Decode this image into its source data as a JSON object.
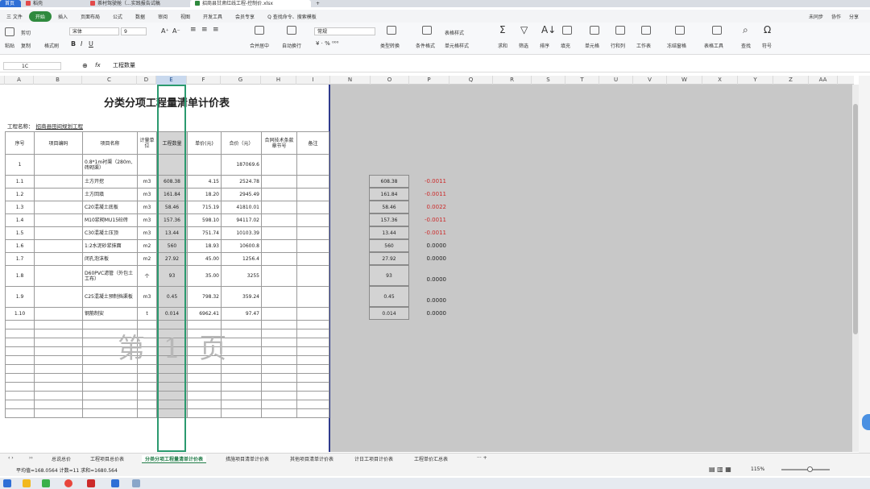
{
  "titlebar": {
    "tabs": [
      "首页",
      "稻壳",
      "茶村驾驶舱（...实践报告试稿",
      "招商县甘肃红线工程-控制价.xlsx",
      "+"
    ]
  },
  "menubar": {
    "items": [
      "三 文件",
      "开始",
      "插入",
      "页面布局",
      "公式",
      "数据",
      "审阅",
      "视图",
      "开发工具",
      "会员专享",
      "Q 查找命令、搜索模板"
    ],
    "right": [
      "未同步",
      "协作",
      "分享"
    ]
  },
  "ribbon": {
    "clipboard": [
      "剪切",
      "粘贴",
      "复制",
      "格式刷"
    ],
    "font_name": "宋体",
    "font_size": "9",
    "format_labels": [
      "合并居中",
      "自动换行"
    ],
    "number_format": "常规",
    "tools": [
      "类型转换",
      "条件格式",
      "表格样式",
      "单元格样式",
      "求和",
      "筛选",
      "排序",
      "填充",
      "单元格",
      "行和列",
      "工作表",
      "冻结窗格",
      "表格工具",
      "查找",
      "符号"
    ]
  },
  "formula_bar": {
    "cell_ref": "1C",
    "fx": "fx",
    "content": "工程数量"
  },
  "columns": [
    "A",
    "B",
    "C",
    "D",
    "E",
    "F",
    "G",
    "H",
    "I",
    "N",
    "O",
    "P",
    "Q",
    "R",
    "S",
    "T",
    "U",
    "V",
    "W",
    "X",
    "Y",
    "Z",
    "AA"
  ],
  "sheet": {
    "title": "分类分项工程量清单计价表",
    "project_label": "工程名称：",
    "project_value": "招商县田间规划工程",
    "headers": [
      "序号",
      "项目编码",
      "项目名称",
      "计量单位",
      "工程数量",
      "单价(元)",
      "合价（元）",
      "合同技术条款章节号",
      "备注"
    ],
    "rows": [
      {
        "no": "1",
        "code": "",
        "name": "0.8*1m衬渠（280m,砖砌渠）",
        "unit": "",
        "qty": "",
        "price": "",
        "total": "187069.6"
      },
      {
        "no": "1.1",
        "code": "",
        "name": "土方开挖",
        "unit": "m3",
        "qty": "608.38",
        "price": "4.15",
        "total": "2524.78"
      },
      {
        "no": "1.2",
        "code": "",
        "name": "土方回填",
        "unit": "m3",
        "qty": "161.84",
        "price": "18.20",
        "total": "2945.49"
      },
      {
        "no": "1.3",
        "code": "",
        "name": "C20混凝土底板",
        "unit": "m3",
        "qty": "58.46",
        "price": "715.19",
        "total": "41810.01"
      },
      {
        "no": "1.4",
        "code": "",
        "name": "M10浆砌MU15砼砖",
        "unit": "m3",
        "qty": "157.36",
        "price": "598.10",
        "total": "94117.02"
      },
      {
        "no": "1.5",
        "code": "",
        "name": "C30混凝土压顶",
        "unit": "m3",
        "qty": "13.44",
        "price": "751.74",
        "total": "10103.39"
      },
      {
        "no": "1.6",
        "code": "",
        "name": "1:2水泥砂浆抹面",
        "unit": "m2",
        "qty": "560",
        "price": "18.93",
        "total": "10600.8"
      },
      {
        "no": "1.7",
        "code": "",
        "name": "闭孔泡沫板",
        "unit": "m2",
        "qty": "27.92",
        "price": "45.00",
        "total": "1256.4"
      },
      {
        "no": "1.8",
        "code": "",
        "name": "D60PVC滤管（外包土工布）",
        "unit": "个",
        "qty": "93",
        "price": "35.00",
        "total": "3255"
      },
      {
        "no": "1.9",
        "code": "",
        "name": "C25混凝土预制挡渠板",
        "unit": "m3",
        "qty": "0.45",
        "price": "798.32",
        "total": "359.24"
      },
      {
        "no": "1.10",
        "code": "",
        "name": "钢筋制安",
        "unit": "t",
        "qty": "0.014",
        "price": "6962.41",
        "total": "97.47"
      }
    ],
    "watermark": "第 1 页"
  },
  "helper": {
    "values": [
      "608.38",
      "161.84",
      "58.46",
      "157.36",
      "13.44",
      "560",
      "27.92",
      "93",
      "0.45",
      "0.014"
    ],
    "diffs": [
      "-0.0011",
      "-0.0011",
      "0.0022",
      "-0.0011",
      "-0.0011",
      "0.0000",
      "0.0000",
      "0.0000",
      "0.0000",
      "0.0000"
    ]
  },
  "sheet_tabs": [
    "总说总价",
    "工程项目总价表",
    "分类分项工程量清单计价表",
    "措施项目清单计价表",
    "其他项目清单计价表",
    "计日工项目计价表",
    "工程单价汇总表"
  ],
  "status": {
    "stats": "平均值=168.0564  计数=11  求和=1680.564",
    "zoom": "115%"
  },
  "colors": {
    "accent": "#2f8a3e",
    "selection": "#2b9a6f",
    "neg": "#cc2a2a"
  }
}
